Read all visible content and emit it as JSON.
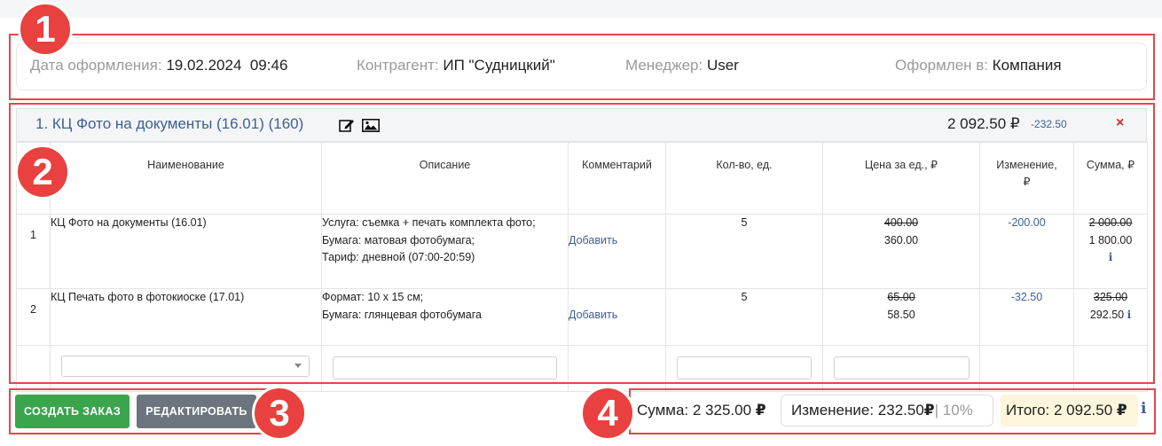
{
  "info": {
    "date_label": "Дата оформления:",
    "date_value": "19.02.2024  09:46",
    "counterparty_label": "Контрагент:",
    "counterparty_value": "ИП \"Судницкий\"",
    "manager_label": "Менеджер:",
    "manager_value": "User",
    "placed_label": "Оформлен в:",
    "placed_value": "Компания"
  },
  "product": {
    "title": "1. КЦ Фото на документы (16.01) (160)",
    "total": "2 092.50 ₽",
    "delta": "-232.50",
    "edit_icon": "edit-icon",
    "image_icon": "image-icon",
    "close_icon": "×"
  },
  "table": {
    "headers": {
      "name": "Наименование",
      "description": "Описание",
      "comment": "Комментарий",
      "qty": "Кол-во, ед.",
      "price_line1": "Цена за ед., ₽",
      "change_line1": "Изменение,",
      "change_line2": "₽",
      "sum": "Сумма, ₽"
    },
    "rows": [
      {
        "num": "1",
        "name": "КЦ Фото на документы (16.01)",
        "desc1": "Услуга: съемка + печать комплекта фото;",
        "desc2": "Бумага: матовая фотобумага;",
        "desc3": "Тариф: дневной (07:00-20:59)",
        "comment": "Добавить",
        "qty": "5",
        "price_old": "400.00",
        "price_new": "360.00",
        "change": "-200.00",
        "sum_old": "2 000.00",
        "sum_new": "1 800.00"
      },
      {
        "num": "2",
        "name": "КЦ Печать фото в фотокиоске (17.01)",
        "desc1": "Формат: 10 х 15 см;",
        "desc2": "Бумага: глянцевая фотобумага",
        "comment": "Добавить",
        "qty": "5",
        "price_old": "65.00",
        "price_new": "58.50",
        "change": "-32.50",
        "sum_old": "325.00",
        "sum_new": "292.50"
      }
    ]
  },
  "buttons": {
    "create": "СОЗДАТЬ ЗАКАЗ",
    "edit": "РЕДАКТИРОВАТЬ"
  },
  "totals": {
    "sum_label": "Сумма: 2 325.00",
    "change_label": "Изменение: 232.50",
    "change_pct": "| 10%",
    "total_label": "Итого: 2 092.50",
    "currency": "₽"
  },
  "badges": [
    "1",
    "2",
    "3",
    "4"
  ],
  "colors": {
    "accent_blue": "#3e5f94",
    "create_green": "#3aa54c",
    "edit_gray": "#6c757d",
    "annotation_red": "#e2474f"
  }
}
